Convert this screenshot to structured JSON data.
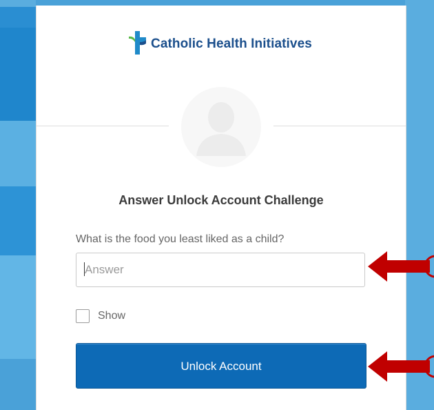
{
  "brand": {
    "name": "Catholic Health Initiatives"
  },
  "form": {
    "title": "Answer Unlock Account Challenge",
    "question": "What is the food you least liked as a child?",
    "answer": {
      "placeholder": "Answer",
      "value": ""
    },
    "show": {
      "label": "Show",
      "checked": false
    },
    "submit_label": "Unlock Account"
  },
  "colors": {
    "brand_text": "#1b4f8c",
    "button": "#0d6ab6",
    "annotation_arrow": "#c00000",
    "background": "#4aa1d8"
  },
  "icons": [
    "logo-cross-icon",
    "user-avatar-icon",
    "red-arrow-icon"
  ]
}
